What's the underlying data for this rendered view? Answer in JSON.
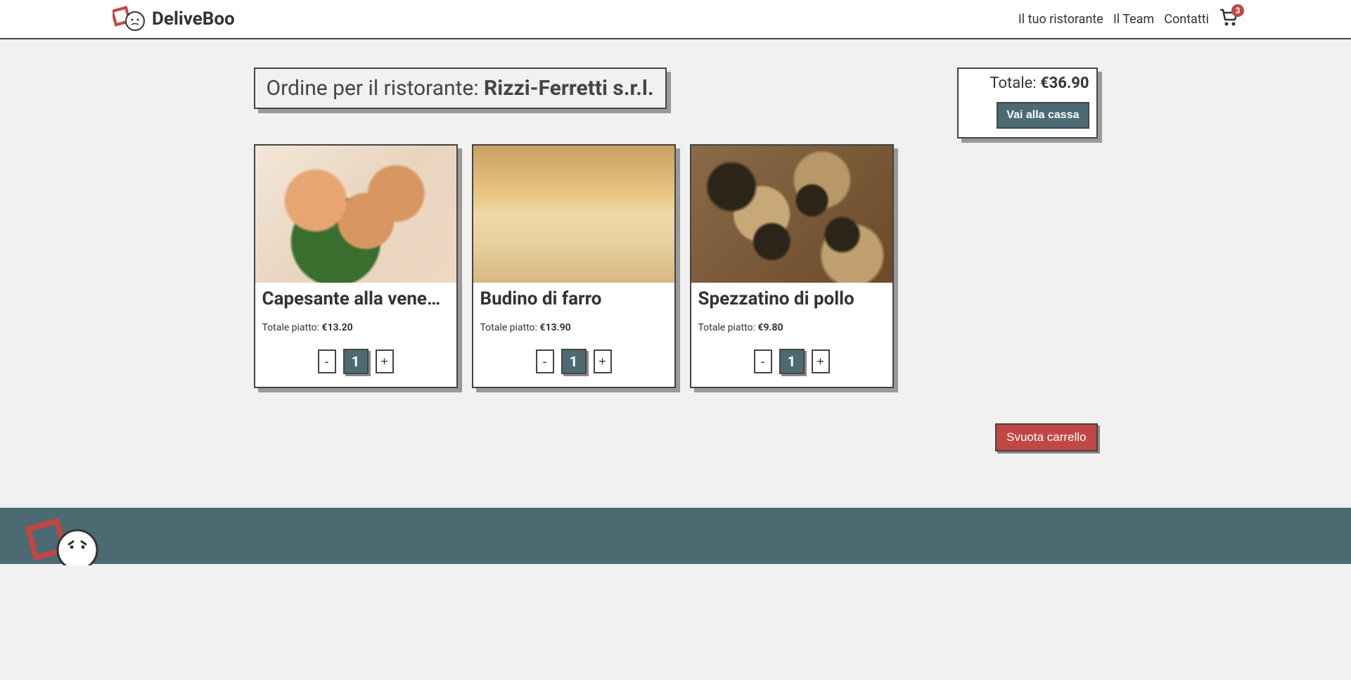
{
  "brand": {
    "name": "DeliveBoo"
  },
  "nav": {
    "restaurant": "Il tuo ristorante",
    "team": "Il Team",
    "contacts": "Contatti",
    "cart_count": "3"
  },
  "order": {
    "title_prefix": "Ordine per il ristorante: ",
    "restaurant_name": "Rizzi-Ferretti s.r.l."
  },
  "summary": {
    "total_label": "Totale: ",
    "total_value": "€36.90",
    "checkout": "Vai alla cassa"
  },
  "items": [
    {
      "name": "Capesante alla veneziana",
      "total_label": "Totale piatto: ",
      "total_value": "€13.20",
      "minus": "-",
      "qty": "1",
      "plus": "+"
    },
    {
      "name": "Budino di farro",
      "total_label": "Totale piatto: ",
      "total_value": "€13.90",
      "minus": "-",
      "qty": "1",
      "plus": "+"
    },
    {
      "name": "Spezzatino di pollo",
      "total_label": "Totale piatto: ",
      "total_value": "€9.80",
      "minus": "-",
      "qty": "1",
      "plus": "+"
    }
  ],
  "actions": {
    "empty_cart": "Svuota carrello"
  }
}
